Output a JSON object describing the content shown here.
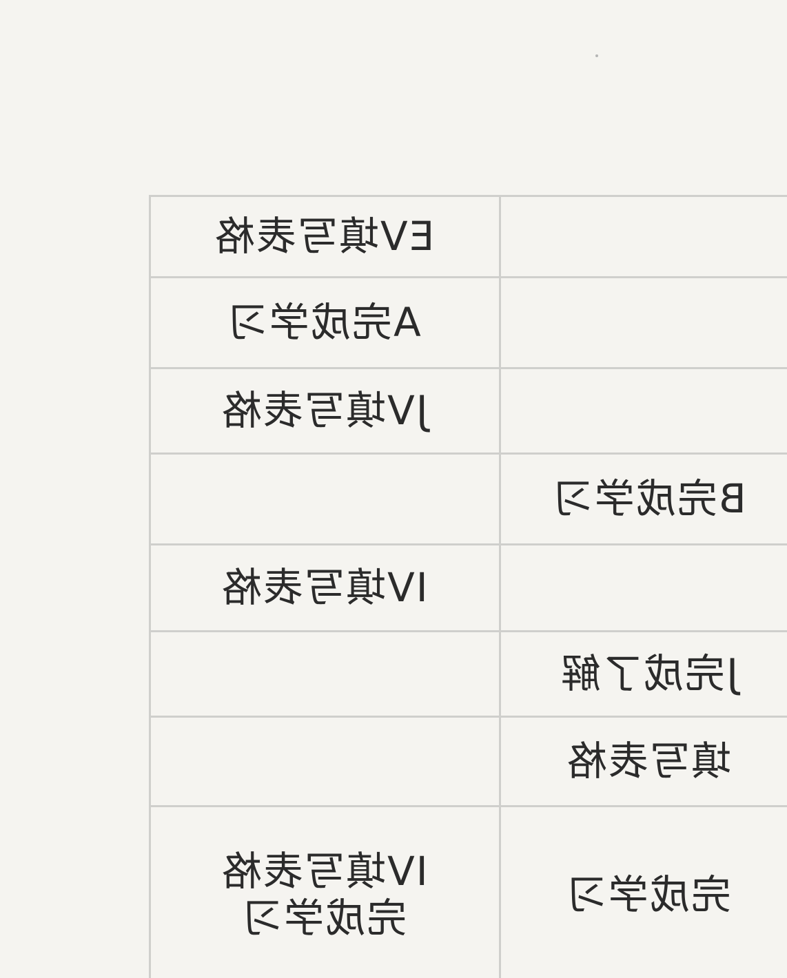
{
  "table": {
    "left_column": [
      "EV填写表格",
      "A完成学习",
      "JV填写表格",
      "",
      "IV填写表格",
      "",
      "",
      "IV填写表格\n完成学习"
    ],
    "right_column": [
      "",
      "",
      "",
      "B完成学习",
      "",
      "J完成了解",
      "填写表格",
      "完成学习"
    ]
  }
}
